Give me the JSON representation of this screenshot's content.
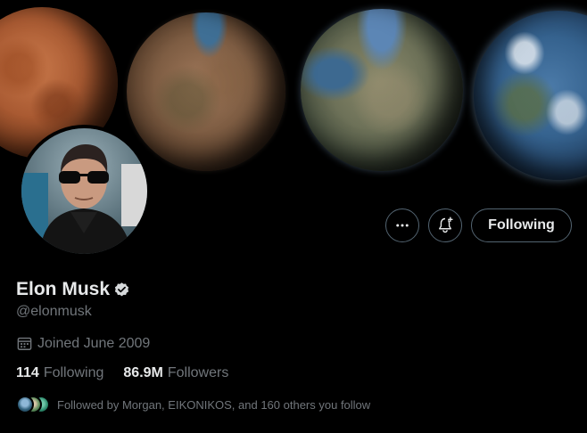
{
  "profile": {
    "display_name": "Elon Musk",
    "handle": "@elonmusk",
    "verified": true,
    "joined": "Joined June 2009"
  },
  "stats": {
    "following_count": "114",
    "following_label": "Following",
    "followers_count": "86.9M",
    "followers_label": "Followers"
  },
  "followed_by": {
    "text": "Followed by Morgan, EIKONIKOS, and 160 others you follow"
  },
  "actions": {
    "more_icon": "more-icon",
    "bell_icon": "bell-plus-icon",
    "following_button_label": "Following"
  },
  "colors": {
    "background": "#000000",
    "primary_text": "#e7e9ea",
    "secondary_text": "#71767b",
    "button_border": "#536471"
  }
}
